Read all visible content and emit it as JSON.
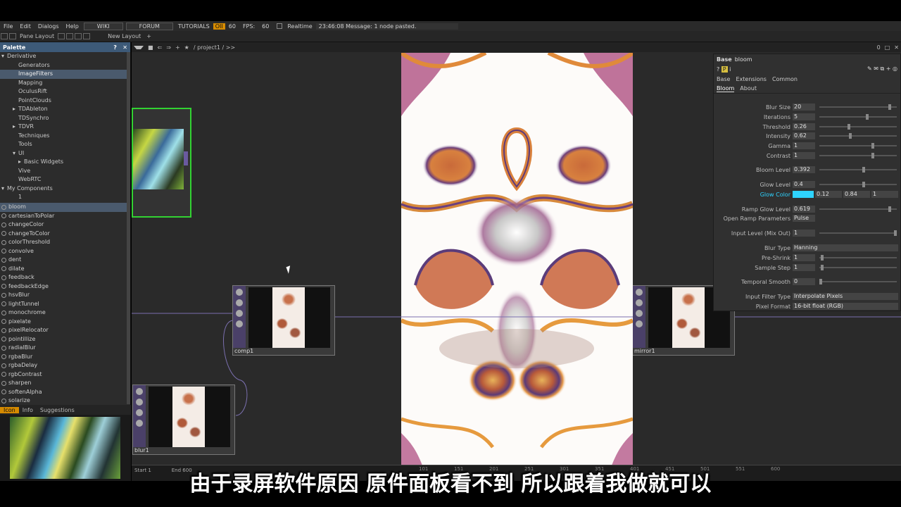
{
  "menu": [
    "File",
    "Edit",
    "Dialogs",
    "Help"
  ],
  "menu_buttons": [
    "WIKI",
    "FORUM",
    "TUTORIALS"
  ],
  "fps_badge": "OII",
  "fps_value": "60",
  "fps_label": "FPS:",
  "fps_num": "60",
  "realtime_label": "Realtime",
  "message": "23:46:08 Message: 1 node pasted.",
  "pane_layout": "Pane Layout",
  "new_layout": "New Layout",
  "network_path": "/ project1 / >>",
  "net_right_num": "0",
  "palette": {
    "title": "Palette",
    "tree": [
      {
        "label": "Derivative",
        "indent": 0,
        "arrow": "down"
      },
      {
        "label": "Generators",
        "indent": 2,
        "arrow": ""
      },
      {
        "label": "ImageFilters",
        "indent": 2,
        "arrow": "",
        "sel": true
      },
      {
        "label": "Mapping",
        "indent": 2,
        "arrow": ""
      },
      {
        "label": "OculusRift",
        "indent": 2,
        "arrow": ""
      },
      {
        "label": "PointClouds",
        "indent": 2,
        "arrow": ""
      },
      {
        "label": "TDAbleton",
        "indent": 2,
        "arrow": "right"
      },
      {
        "label": "TDSynchro",
        "indent": 2,
        "arrow": ""
      },
      {
        "label": "TDVR",
        "indent": 2,
        "arrow": "right"
      },
      {
        "label": "Techniques",
        "indent": 2,
        "arrow": ""
      },
      {
        "label": "Tools",
        "indent": 2,
        "arrow": ""
      },
      {
        "label": "UI",
        "indent": 2,
        "arrow": "down"
      },
      {
        "label": "Basic Widgets",
        "indent": 3,
        "arrow": "right"
      },
      {
        "label": "Vive",
        "indent": 2,
        "arrow": ""
      },
      {
        "label": "WebRTC",
        "indent": 2,
        "arrow": ""
      },
      {
        "label": "My Components",
        "indent": 0,
        "arrow": "down"
      },
      {
        "label": "1",
        "indent": 2,
        "arrow": ""
      }
    ],
    "components": [
      "bloom",
      "cartesianToPolar",
      "changeColor",
      "changeToColor",
      "colorThreshold",
      "convolve",
      "dent",
      "dilate",
      "feedback",
      "feedbackEdge",
      "hsvBlur",
      "lightTunnel",
      "monochrome",
      "pixelate",
      "pixelRelocator",
      "pointillize",
      "radialBlur",
      "rgbaBlur",
      "rgbaDelay",
      "rgbContrast",
      "sharpen",
      "softenAlpha",
      "solarize"
    ]
  },
  "preview_tabs": [
    "Icon",
    "Info",
    "Suggestions"
  ],
  "nodes": {
    "comp1": "comp1",
    "mirror1": "mirror1",
    "blur1": "blur1"
  },
  "params": {
    "header_type": "Base",
    "header_name": "bloom",
    "tabs_top": [
      "Base",
      "Extensions",
      "Common"
    ],
    "tabs_sub": [
      "Bloom",
      "About"
    ],
    "rows": [
      {
        "label": "Blur Size",
        "value": "20",
        "knob": 0.92
      },
      {
        "label": "Iterations",
        "value": "5",
        "knob": 0.62
      },
      {
        "label": "Threshold",
        "value": "0.26",
        "knob": 0.38
      },
      {
        "label": "Intensity",
        "value": "0.62",
        "knob": 0.4
      },
      {
        "label": "Gamma",
        "value": "1",
        "knob": 0.7
      },
      {
        "label": "Contrast",
        "value": "1",
        "knob": 0.7
      },
      {
        "label": "Bloom Level",
        "value": "0.392",
        "knob": 0.58
      },
      {
        "label": "Glow Level",
        "value": "0.4",
        "knob": 0.58
      },
      {
        "label": "Ramp Glow Level",
        "value": "0.619",
        "knob": 0.92
      },
      {
        "label": "Input Level (Mix Out)",
        "value": "1",
        "knob": 1.0
      },
      {
        "label": "Pre-Shrink",
        "value": "1",
        "knob": 0.02
      },
      {
        "label": "Sample Step",
        "value": "1",
        "knob": 0.02
      },
      {
        "label": "Temporal Smooth",
        "value": "0",
        "knob": 0.0
      }
    ],
    "glow_color_label": "Glow Color",
    "glow_color": "#2ed3ff",
    "glow_g": "0.12",
    "glow_b": "0.84",
    "glow_a": "1",
    "open_ramp_label": "Open Ramp Parameters",
    "open_ramp_value": "Pulse",
    "blur_type_label": "Blur Type",
    "blur_type_value": "Hanning",
    "input_filter_label": "Input Filter Type",
    "input_filter_value": "Interpolate Pixels",
    "pixel_format_label": "Pixel Format",
    "pixel_format_value": "16-bit float (RGB)"
  },
  "timeline": {
    "start_label": "Start",
    "start_value": "1",
    "end_label": "End",
    "end_value": "600",
    "ticks": [
      "101",
      "151",
      "201",
      "251",
      "301",
      "351",
      "401",
      "451",
      "501",
      "551",
      "600"
    ]
  },
  "subtitle": "由于录屏软件原因 原件面板看不到 所以跟着我做就可以"
}
